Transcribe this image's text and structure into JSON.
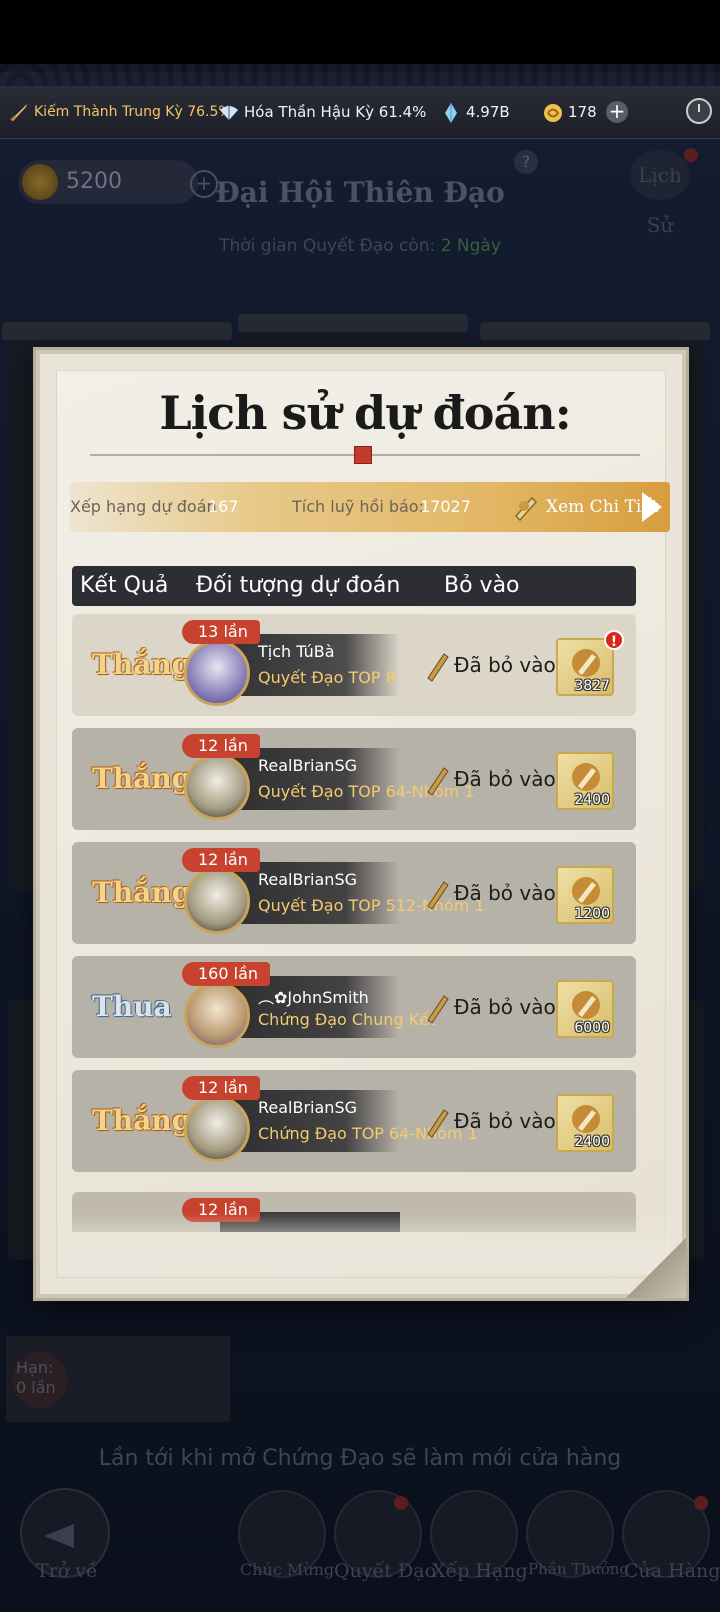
{
  "resources": {
    "realm1": "Kiếm Thành Trung Kỳ 76.5%",
    "realm2": "Hóa Thần Hậu Kỳ 61.4%",
    "spirit_stones": "4.97B",
    "jade": "178"
  },
  "background": {
    "coins": "5200",
    "title": "Đại Hội Thiên Đạo",
    "time_label": "Thời gian Quyết Đạo còn:",
    "time_value": "2 Ngày",
    "history_button": "Lịch Sử",
    "shop_refresh_msg": "Lần tới khi mở Chứng Đạo sẽ làm mới cửa hàng",
    "limit_label": "Hạn: 0 lần",
    "nav": {
      "back": "Trở về",
      "congrats": "Chúc Mừng",
      "decide": "Quyết Đạo",
      "ranking": "Xếp Hạng",
      "rewards": "Phần Thưởng",
      "shop": "Cửa Hàng"
    }
  },
  "popup": {
    "title": "Lịch sử dự đoán:",
    "rank_label": "Xếp hạng dự đoán",
    "rank_value": "167",
    "reward_label": "Tích luỹ hồi báo",
    "reward_value": "17027",
    "details_button": "Xem Chi Tiết",
    "columns": [
      "Kết Quả",
      "Đối tượng dự đoán",
      "Bỏ vào"
    ],
    "rows": [
      {
        "result": "Thắng",
        "outcome": "win",
        "times": "13 lần",
        "player": "Tịch   TúBà",
        "stage": "Quyết Đạo TOP 8",
        "bet_label": "Đã bỏ vào 1",
        "amount": "3827",
        "alert": true
      },
      {
        "result": "Thắng",
        "outcome": "win",
        "times": "12 lần",
        "player": "RealBrianSG",
        "stage": "Quyết Đạo TOP 64-Nhóm 1",
        "bet_label": "Đã bỏ vào 1",
        "amount": "2400",
        "alert": false
      },
      {
        "result": "Thắng",
        "outcome": "win",
        "times": "12 lần",
        "player": "RealBrianSG",
        "stage": "Quyết Đạo TOP 512-Nhóm 1",
        "bet_label": "Đã bỏ vào 1",
        "amount": "1200",
        "alert": false
      },
      {
        "result": "Thua",
        "outcome": "lose",
        "times": "160 lần",
        "player": "︵✿JohnSmith",
        "stage": "Chứng Đạo Chung Kết",
        "bet_label": "Đã bỏ vào 6",
        "amount": "6000",
        "alert": false
      },
      {
        "result": "Thắng",
        "outcome": "win",
        "times": "12 lần",
        "player": "RealBrianSG",
        "stage": "Chứng Đạo TOP 64-Nhóm 1",
        "bet_label": "Đã bỏ vào 1",
        "amount": "2400",
        "alert": false
      }
    ],
    "partial_row_times": "12 lần"
  },
  "colors": {
    "win": "#f4d38a",
    "lose": "#d9e4ef",
    "tag": "#c8432f",
    "stage": "#f4cb6e",
    "alert": "#d8251d"
  }
}
